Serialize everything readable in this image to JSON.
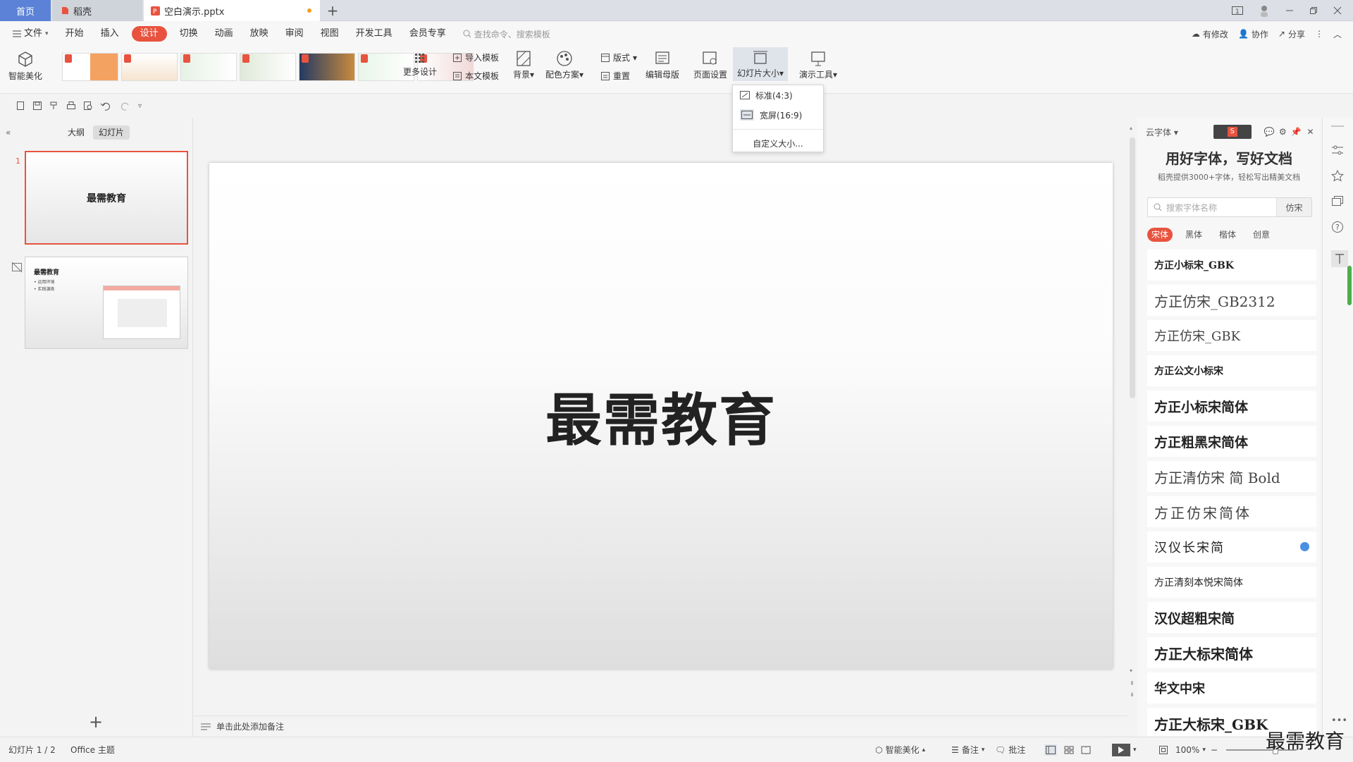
{
  "tabs": {
    "home": "首页",
    "docer": "稻壳",
    "file": "空白演示.pptx",
    "add": "+"
  },
  "window": {
    "title_icons": [
      "layout-icon",
      "avatar",
      "minimize-icon",
      "restore-icon",
      "close-icon"
    ]
  },
  "menu": {
    "file": "文件",
    "items": [
      "开始",
      "插入",
      "设计",
      "切换",
      "动画",
      "放映",
      "审阅",
      "视图",
      "开发工具",
      "会员专享"
    ],
    "active": "设计",
    "search_placeholder": "查找命令、搜索模板",
    "modified": "有修改",
    "collab": "协作",
    "share": "分享"
  },
  "ribbon": {
    "smart_beautify": "智能美化",
    "more_design": "更多设计",
    "import_template": "导入模板",
    "this_template": "本文模板",
    "background": "背景",
    "color_scheme": "配色方案",
    "layout": "版式",
    "reset": "重置",
    "edit_master": "编辑母版",
    "page_setup": "页面设置",
    "slide_size": "幻灯片大小",
    "present_tools": "演示工具"
  },
  "dropdown": {
    "standard": "标准(4:3)",
    "widescreen": "宽屏(16:9)",
    "custom": "自定义大小..."
  },
  "left_panel": {
    "tab_outline": "大纲",
    "tab_slides": "幻灯片",
    "slide1_num": "1",
    "slide1_title": "最需教育",
    "slide2_title": "最需教育",
    "slide2_bullets": [
      "• 运用环境",
      "• 实践演练"
    ]
  },
  "slide": {
    "title": "最需教育"
  },
  "notes": {
    "placeholder": "单击此处添加备注"
  },
  "right_panel": {
    "cloud_font": "云字体",
    "title": "用好字体，写好文档",
    "subtitle": "稻壳提供3000+字体，轻松写出精美文档",
    "search_placeholder": "搜索字体名称",
    "search_sample": "仿宋",
    "categories": [
      "宋体",
      "黑体",
      "楷体",
      "创意"
    ],
    "active_category": "宋体",
    "fonts": [
      "方正小标宋_GBK",
      "方正仿宋_GB2312",
      "方正仿宋_GBK",
      "方正公文小标宋",
      "方正小标宋简体",
      "方正粗黑宋简体",
      "方正清仿宋 简 Bold",
      "方正仿宋简体",
      "汉仪长宋简",
      "方正清刻本悦宋简体",
      "汉仪超粗宋简",
      "方正大标宋简体",
      "华文中宋",
      "方正大标宋_GBK"
    ]
  },
  "status": {
    "slide_count": "幻灯片 1 / 2",
    "theme": "Office 主题",
    "smart_beautify": "智能美化",
    "notes": "备注",
    "comments": "批注",
    "zoom": "100%"
  },
  "watermark": "最需教育",
  "colors": {
    "accent": "#e8533f",
    "home_tab": "#5b82d6"
  }
}
